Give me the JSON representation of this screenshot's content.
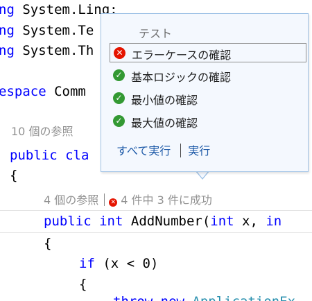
{
  "code": {
    "using1": {
      "kw": "ng",
      "rest": " System.Linq;"
    },
    "using2": {
      "kw": "ng",
      "rest": " System.Te"
    },
    "using3": {
      "kw": "ng",
      "rest": " System.Th"
    },
    "namespace": {
      "kw": "espace",
      "rest": " Comm"
    },
    "class_refs": "10 個の参照",
    "class_decl": {
      "kw1": "public",
      "kw2": "cla"
    },
    "brace_open": "{",
    "method_refs": "4 個の参照",
    "method_status": "4 件中 3 件に成功",
    "method_decl": {
      "kw1": "public",
      "kw2": "int",
      "name": "AddNumber(",
      "kw3": "int",
      "param": " x, ",
      "kw4": "in"
    },
    "method_brace": "{",
    "if_line": {
      "kw": "if",
      "rest": " (x < 0)"
    },
    "if_brace": "{",
    "throw_line": {
      "kw": "throw new",
      "type": "ApplicationEx"
    }
  },
  "popup": {
    "header": "テスト",
    "items": [
      {
        "label": "エラーケースの確認",
        "status": "fail"
      },
      {
        "label": "基本ロジックの確認",
        "status": "pass"
      },
      {
        "label": "最小値の確認",
        "status": "pass"
      },
      {
        "label": "最大値の確認",
        "status": "pass"
      }
    ],
    "run_all": "すべて実行",
    "run": "実行"
  },
  "colors": {
    "fail": "#e51400",
    "pass": "#339933",
    "link": "#1e5aa8",
    "keyword": "#0000ff",
    "type": "#2b91af"
  },
  "icons": {
    "fail": "x-circle-icon",
    "pass": "check-circle-icon"
  }
}
